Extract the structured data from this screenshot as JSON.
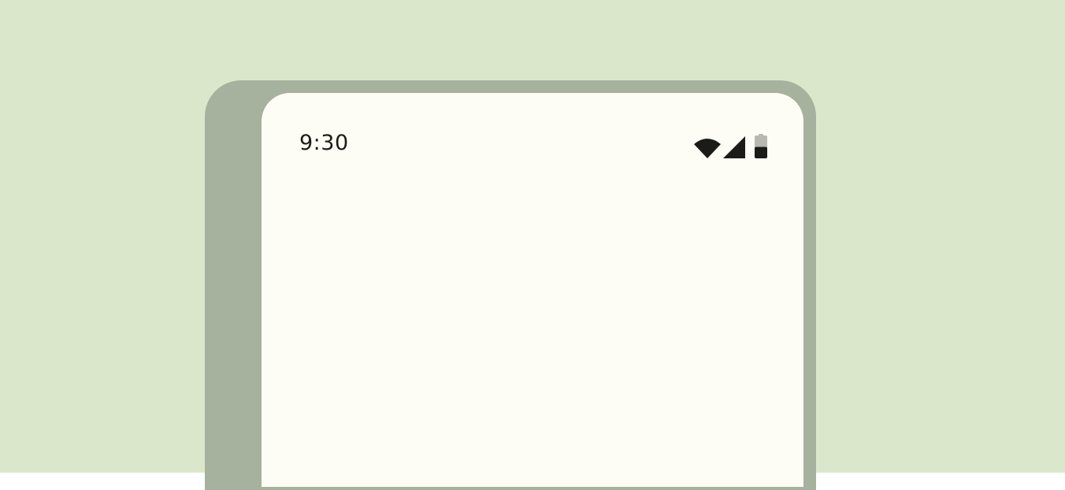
{
  "colors": {
    "background": "#dbe7cb",
    "frame": "#a6b19e",
    "screen": "#fdfdf5",
    "icon_fg": "#1b1c18",
    "battery_empty": "#b8b8b0"
  },
  "status_bar": {
    "time": "9:30",
    "icons": [
      "wifi-icon",
      "cellular-signal-icon",
      "battery-icon"
    ],
    "battery_level": 0.5
  }
}
